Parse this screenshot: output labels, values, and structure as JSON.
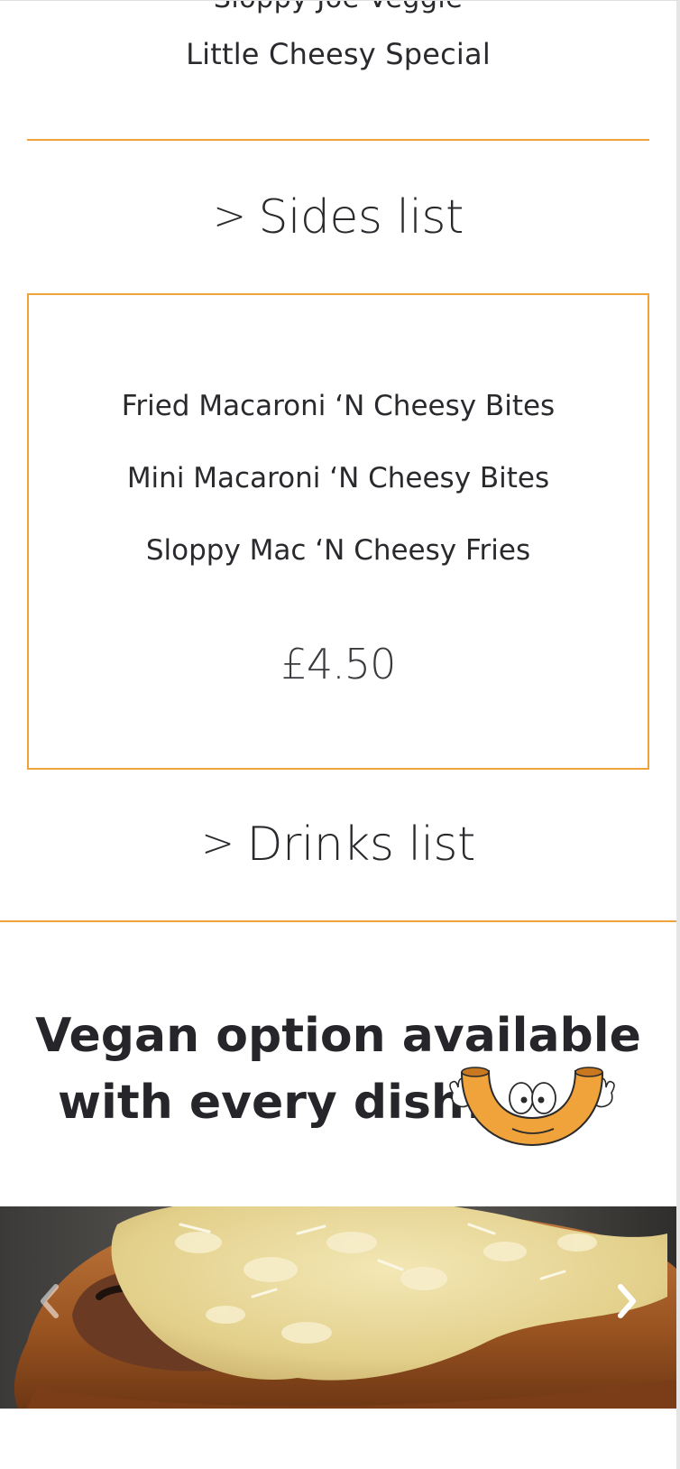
{
  "top": {
    "cut_text": "Sloppy Joe Veggie",
    "special_item": "Little Cheesy Special"
  },
  "sides": {
    "link_label": "Sides list",
    "items": [
      "Fried Macaroni ‘N Cheesy Bites",
      "Mini Macaroni ‘N Cheesy Bites",
      "Sloppy Mac ‘N Cheesy Fries"
    ],
    "price": "£4.50"
  },
  "drinks": {
    "link_label": "Drinks list"
  },
  "vegan": {
    "line1": "Vegan option available",
    "line2": "with every dish!"
  },
  "icons": {
    "chevron": "chevron-right-icon",
    "mascot": "macaroni-mascot-icon",
    "carousel_prev": "chevron-left-icon",
    "carousel_next": "chevron-right-icon"
  },
  "colors": {
    "accent": "#f0a23b",
    "text": "#2a2a2e",
    "mascot_orange": "#f0a23b"
  }
}
